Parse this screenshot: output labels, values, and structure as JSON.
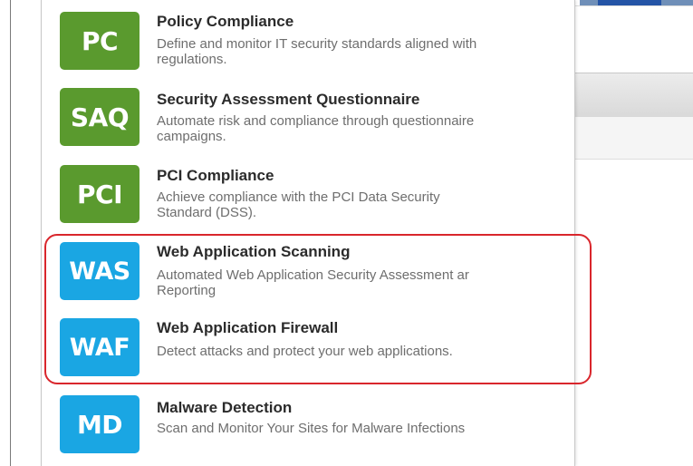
{
  "colors": {
    "green_tile": "#5a9a2e",
    "blue_tile": "#1aa6e3",
    "highlight": "#d9262c"
  },
  "apps": [
    {
      "abbr": "PC",
      "title": "Policy Compliance",
      "description_line1": "Define and monitor IT security standards aligned with",
      "description_line2": "regulations.",
      "color": "green"
    },
    {
      "abbr": "SAQ",
      "title": "Security Assessment Questionnaire",
      "description_line1": "Automate risk and compliance through questionnaire",
      "description_line2": "campaigns.",
      "color": "green"
    },
    {
      "abbr": "PCI",
      "title": "PCI Compliance",
      "description_line1": "Achieve compliance with the PCI Data Security",
      "description_line2": "Standard (DSS).",
      "color": "green"
    },
    {
      "abbr": "WAS",
      "title": "Web Application Scanning",
      "description_line1": "Automated Web Application Security Assessment ar",
      "description_line2": "Reporting",
      "color": "blue"
    },
    {
      "abbr": "WAF",
      "title": "Web Application Firewall",
      "description_line1": "Detect attacks and protect your web applications.",
      "description_line2": "",
      "color": "blue"
    },
    {
      "abbr": "MD",
      "title": "Malware Detection",
      "description_line1": "Scan and Monitor Your Sites for Malware Infections",
      "description_line2": "",
      "color": "blue"
    }
  ]
}
